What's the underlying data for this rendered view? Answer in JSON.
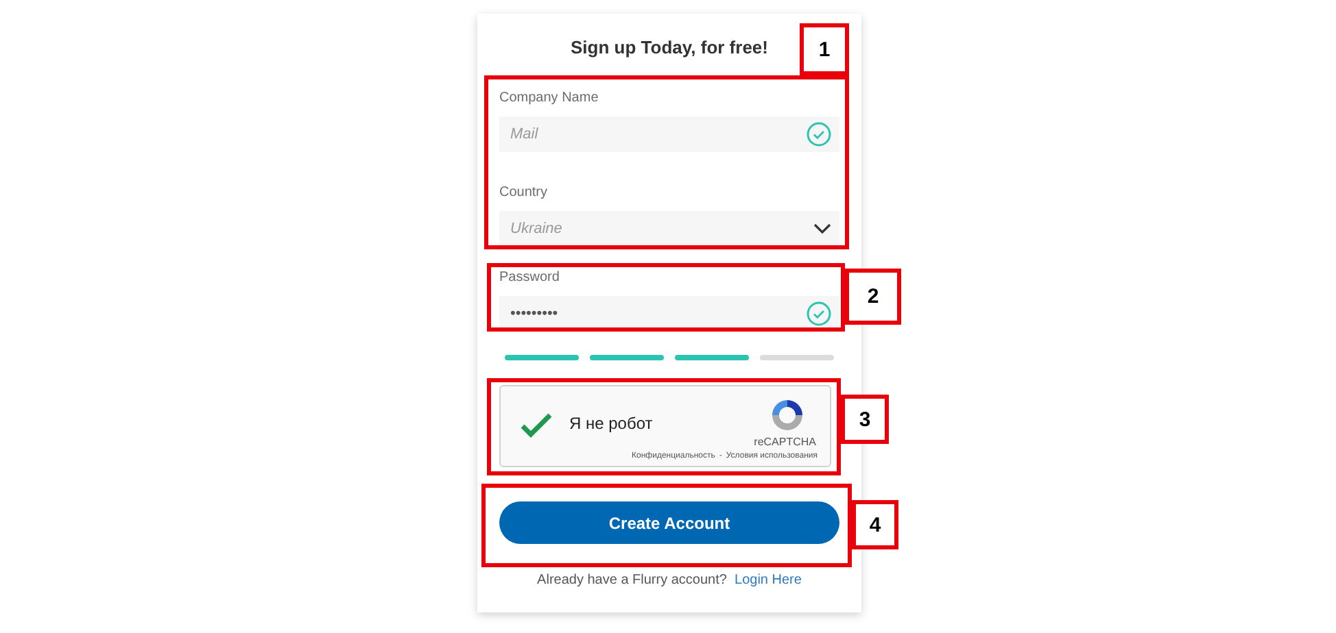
{
  "form": {
    "title": "Sign up Today, for free!",
    "fields": [
      {
        "kind": "text",
        "label": "Company Name",
        "placeholder": "Mail",
        "valid": true
      },
      {
        "kind": "select",
        "label": "Country",
        "placeholder": "Ukraine"
      },
      {
        "kind": "password",
        "label": "Password",
        "value": "•••••••••",
        "valid": true
      }
    ],
    "strength_segments": [
      {
        "on": true
      },
      {
        "on": true
      },
      {
        "on": true
      },
      {
        "on": false
      }
    ],
    "captcha": {
      "label": "Я не робот",
      "checked": true,
      "brand": "reCAPTCHA",
      "privacy": "Конфиденциальность",
      "separator": "-",
      "terms": "Условия использования"
    },
    "submit": "Create Account",
    "footer": {
      "text": "Already have a Flurry account?",
      "link": "Login Here"
    }
  },
  "annotations": [
    {
      "number": "1"
    },
    {
      "number": "2"
    },
    {
      "number": "3"
    },
    {
      "number": "4"
    }
  ]
}
